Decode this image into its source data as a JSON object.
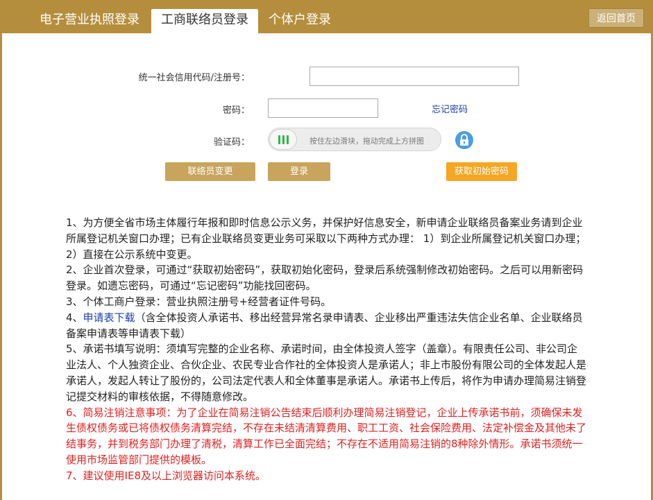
{
  "tabs": [
    {
      "label": "电子营业执照登录",
      "active": false
    },
    {
      "label": "工商联络员登录",
      "active": true
    },
    {
      "label": "个体户登录",
      "active": false
    }
  ],
  "header": {
    "back_label": "返回首页"
  },
  "form": {
    "credit_code_label": "统一社会信用代码/注册号：",
    "credit_code_value": "",
    "password_label": "密码：",
    "password_value": "",
    "forgot_label": "忘记密码",
    "captcha_label": "验证码：",
    "slider_hint": "按住左边滑块，拖动完成上方拼图"
  },
  "buttons": {
    "change_contact": "联络员变更",
    "login": "登录",
    "get_initial_password": "获取初始密码"
  },
  "notes": {
    "n1": "1、为方便全省市场主体履行年报和即时信息公示义务，并保护好信息安全，新申请企业联络员备案业务请到企业所属登记机关窗口办理；已有企业联络员变更业务可采取以下两种方式办理： 1）到企业所属登记机关窗口办理；2）直接在公示系统中变更。",
    "n2": "2、企业首次登录，可通过“获取初始密码”，获取初始化密码，登录后系统强制修改初始密码。之后可以用新密码登录。如遗忘密码，可通过“忘记密码”功能找回密码。",
    "n3": "3、个体工商户登录：营业执照注册号+经营者证件号码。",
    "n4_prefix": "4、",
    "n4_link": "申请表下载",
    "n4_rest": "（含全体投资人承诺书、移出经营异常名录申请表、企业移出严重违法失信企业名单、企业联络员备案申请表等申请表下载）",
    "n5": "5、承诺书填写说明：须填写完整的企业名称、承诺时间，由全体投资人签字（盖章）。有限责任公司、非公司企业法人、个人独资企业、合伙企业、农民专业合作社的全体投资人是承诺人；非上市股份有限公司的全体发起人是承诺人，发起人转让了股份的，公司法定代表人和全体董事是承诺人。承诺书上传后，将作为申请办理简易注销登记提交材料的审核依据，不得随意修改。",
    "n6": "6、简易注销注意事项：为了企业在简易注销公告结束后顺利办理简易注销登记，企业上传承诺书前，须确保未发生债权债务或已将债权债务清算完结，不存在未结清清算费用、职工工资、社会保险费用、法定补偿金及其他未了结事务，并到税务部门办理了清税，清算工作已全面完结；不存在不适用简易注销的8种除外情形。承诺书须统一使用市场监管部门提供的模板。",
    "n7": "7、建议使用IE8及以上浏览器访问本系统。"
  },
  "colors": {
    "brand": "#b58e3d",
    "accent_orange": "#f5a623",
    "link": "#1b3fa8",
    "warning": "#e02020"
  }
}
